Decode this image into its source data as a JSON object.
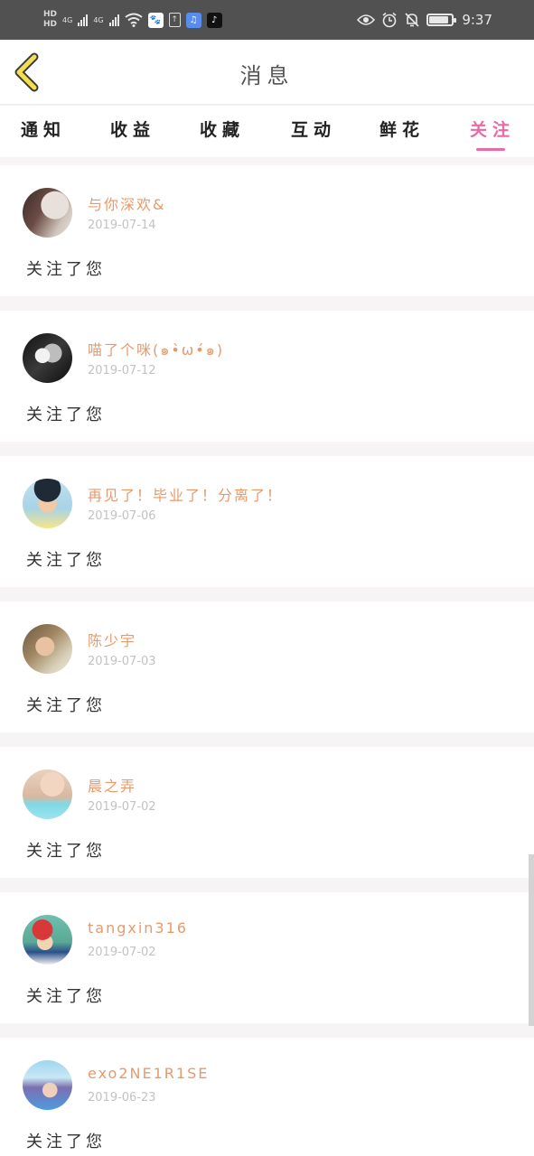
{
  "status_bar": {
    "hd1": "HD",
    "hd2": "HD",
    "net1": "4G",
    "net2": "4G",
    "time": "9:37",
    "battery_level": 0.85
  },
  "header": {
    "title": "消息"
  },
  "tabs": [
    {
      "label": "通知",
      "active": false
    },
    {
      "label": "收益",
      "active": false
    },
    {
      "label": "收藏",
      "active": false
    },
    {
      "label": "互动",
      "active": false
    },
    {
      "label": "鲜花",
      "active": false
    },
    {
      "label": "关注",
      "active": true
    }
  ],
  "messages": [
    {
      "name": "与你深欢&",
      "date": "2019-07-14",
      "text": "关注了您"
    },
    {
      "name": "喵了个咪(๑•̀ω•́๑)",
      "date": "2019-07-12",
      "text": "关注了您"
    },
    {
      "name": "再见了！毕业了！分离了！",
      "date": "2019-07-06",
      "text": "关注了您"
    },
    {
      "name": "陈少宇",
      "date": "2019-07-03",
      "text": "关注了您"
    },
    {
      "name": "晨之弄",
      "date": "2019-07-02",
      "text": "关注了您"
    },
    {
      "name": "tangxin316",
      "date": "2019-07-02",
      "text": "关注了您"
    },
    {
      "name": "exo2NE1R1SE",
      "date": "2019-06-23",
      "text": "关注了您"
    }
  ],
  "colors": {
    "accent": "#e96aa6",
    "username": "#e69a6c",
    "date": "#c2c2c2"
  }
}
